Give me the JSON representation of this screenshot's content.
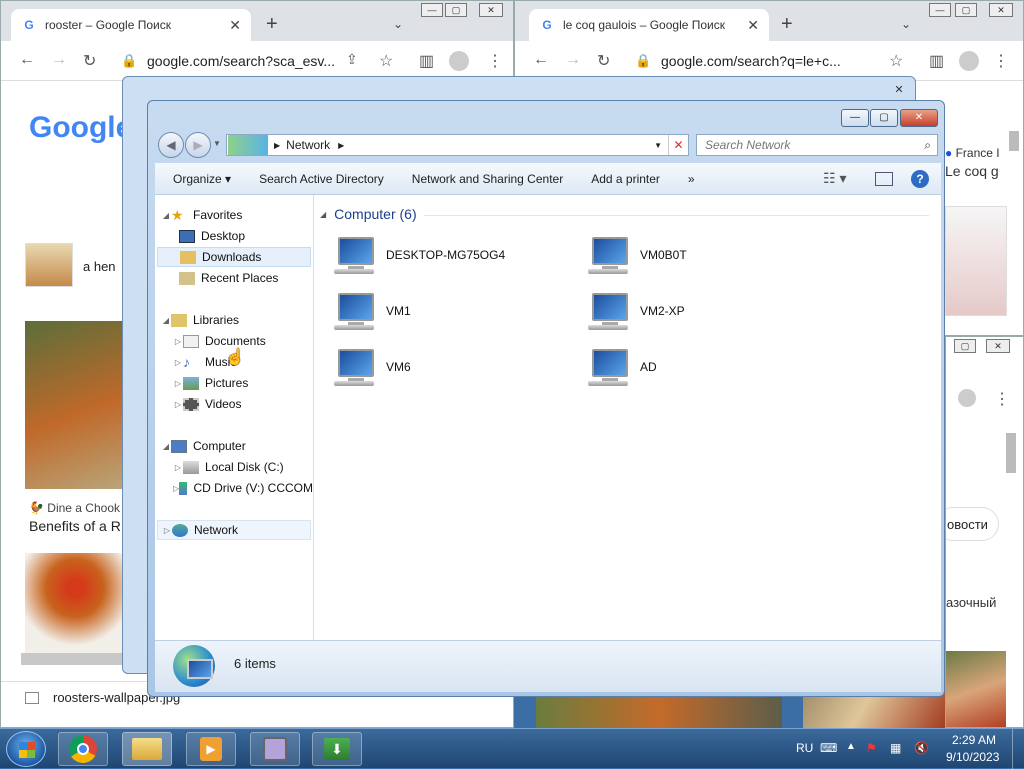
{
  "browser_left": {
    "tab_title": "rooster – Google Поиск",
    "url": "google.com/search?sca_esv...",
    "google_logo": "Google",
    "result_a_hen": "a hen",
    "result_source": "Dine a Chook",
    "result_title": "Benefits of a R",
    "download_file": "roosters-wallpaper.jpg"
  },
  "browser_right": {
    "tab_title": "le coq gaulois – Google Поиск",
    "url": "google.com/search?q=le+c...",
    "source": "France I",
    "snippet": "Le coq g",
    "news_button": "овости",
    "bottom_text": "азочный"
  },
  "explorer": {
    "address_crumb": "Network",
    "search_placeholder": "Search Network",
    "commands": {
      "organize": "Organize",
      "search_ad": "Search Active Directory",
      "network_sharing": "Network and Sharing Center",
      "add_printer": "Add a printer",
      "more": "»"
    },
    "nav": {
      "favorites": "Favorites",
      "desktop": "Desktop",
      "downloads": "Downloads",
      "recent_places": "Recent Places",
      "libraries": "Libraries",
      "documents": "Documents",
      "music": "Music",
      "pictures": "Pictures",
      "videos": "Videos",
      "computer": "Computer",
      "local_disk": "Local Disk (C:)",
      "cd_drive": "CD Drive (V:) CCCOM",
      "network": "Network"
    },
    "group_header": "Computer (6)",
    "computers": [
      "DESKTOP-MG75OG4",
      "VM0B0T",
      "VM1",
      "VM2-XP",
      "VM6",
      "AD"
    ],
    "status_count": "6 items"
  },
  "taskbar": {
    "language": "RU",
    "time": "2:29 AM",
    "date": "9/10/2023"
  },
  "colors": {
    "taskbar": "#1f4672",
    "explorer_chrome": "#a9c6e6",
    "google_blue": "#4285f4"
  }
}
